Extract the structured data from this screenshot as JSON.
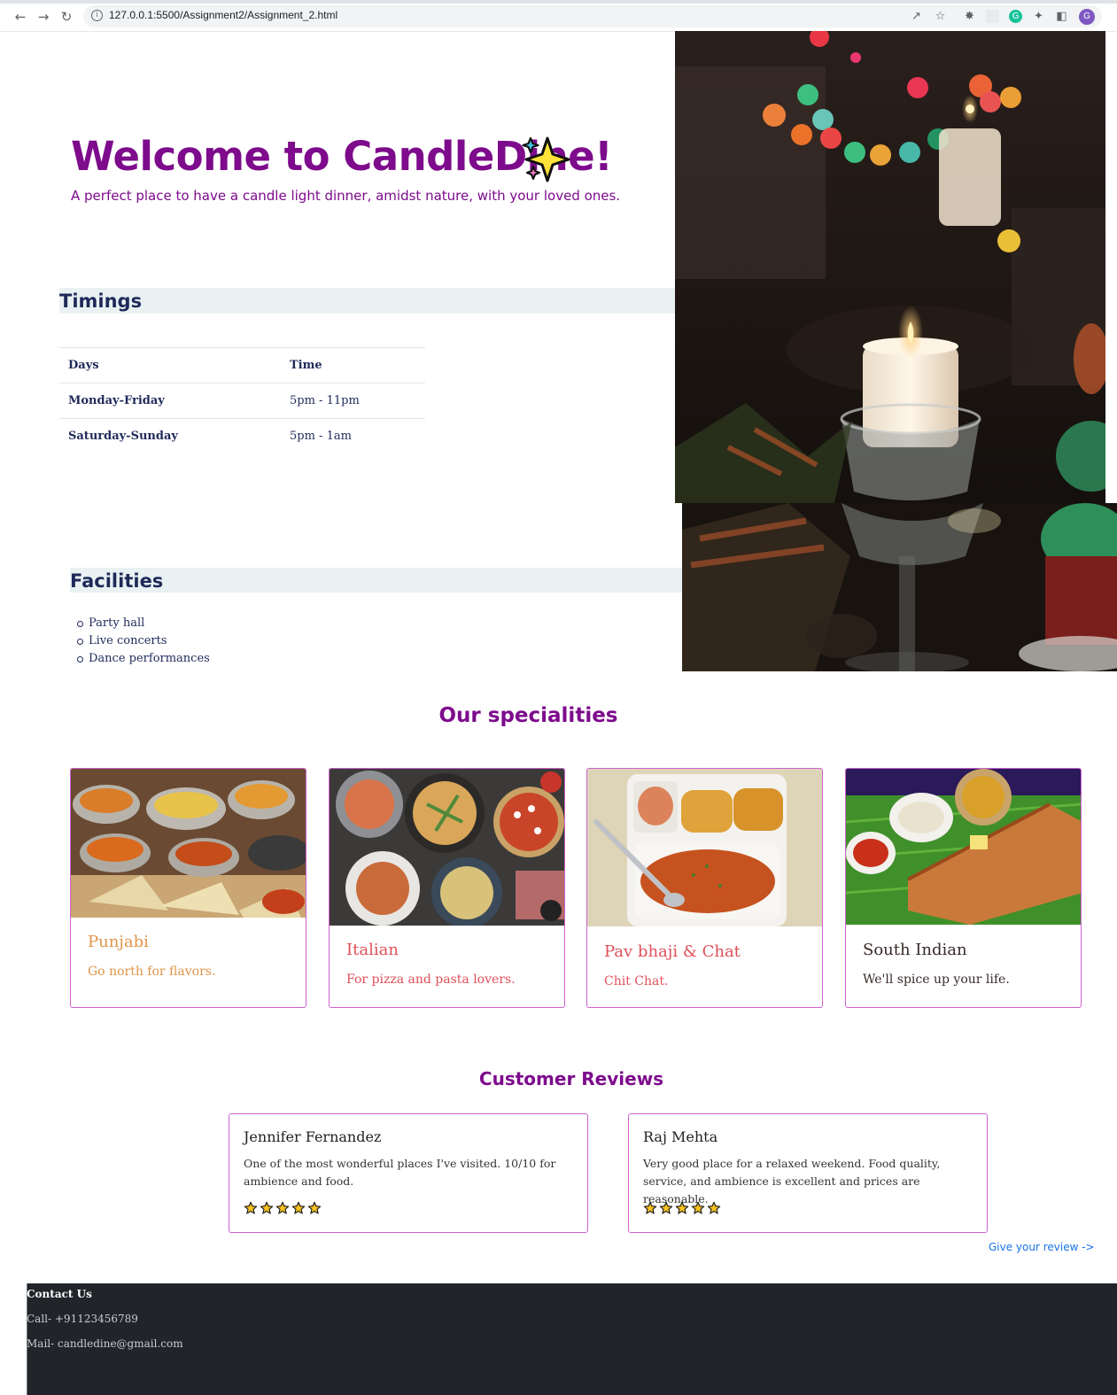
{
  "browser": {
    "url": "127.0.0.1:5500/Assignment2/Assignment_2.html",
    "profile_initial": "G",
    "icons": [
      "back-icon",
      "forward-icon",
      "reload-icon",
      "info-icon",
      "share-icon",
      "star-icon",
      "bug-icon",
      "extension-icon",
      "grammarly-icon",
      "puzzle-icon",
      "sidebar-icon"
    ]
  },
  "hero": {
    "title": "Welcome to CandleDine!",
    "subtitle": "A perfect place to have a candle light dinner, amidst nature, with your loved ones."
  },
  "timings": {
    "heading": "Timings",
    "headers": [
      "Days",
      "Time"
    ],
    "rows": [
      {
        "day": "Monday-Friday",
        "time": "5pm - 11pm"
      },
      {
        "day": "Saturday-Sunday",
        "time": "5pm - 1am"
      }
    ]
  },
  "facilities": {
    "heading": "Facilities",
    "items": [
      "Party hall",
      "Live concerts",
      "Dance performances",
      ""
    ]
  },
  "specialities": {
    "heading": "Our specialities",
    "cards": [
      {
        "name": "Punjabi",
        "desc": "Go north for flavors.",
        "color": "#e0954a"
      },
      {
        "name": "Italian",
        "desc": "For pizza and pasta lovers.",
        "color": "#e0505a"
      },
      {
        "name": "Pav bhaji & Chat",
        "desc": "Chit Chat.",
        "color": "#e0505a"
      },
      {
        "name": "South Indian",
        "desc": "We'll spice up your life.",
        "color": "#3a2a2a"
      }
    ]
  },
  "reviews": {
    "heading": "Customer Reviews",
    "items": [
      {
        "name": "Jennifer Fernandez",
        "text": "One of the most wonderful places I've visited. 10/10 for ambience and food.",
        "rating": 5
      },
      {
        "name": "Raj Mehta",
        "text": "Very good place for a relaxed weekend. Food quality, service, and ambience is excellent and prices are reasonable.",
        "rating": 5
      }
    ],
    "give_review": "Give your review ->"
  },
  "footer": {
    "heading": "Contact Us",
    "call": "Call- +91123456789",
    "mail": "Mail- candledine@gmail.com"
  }
}
